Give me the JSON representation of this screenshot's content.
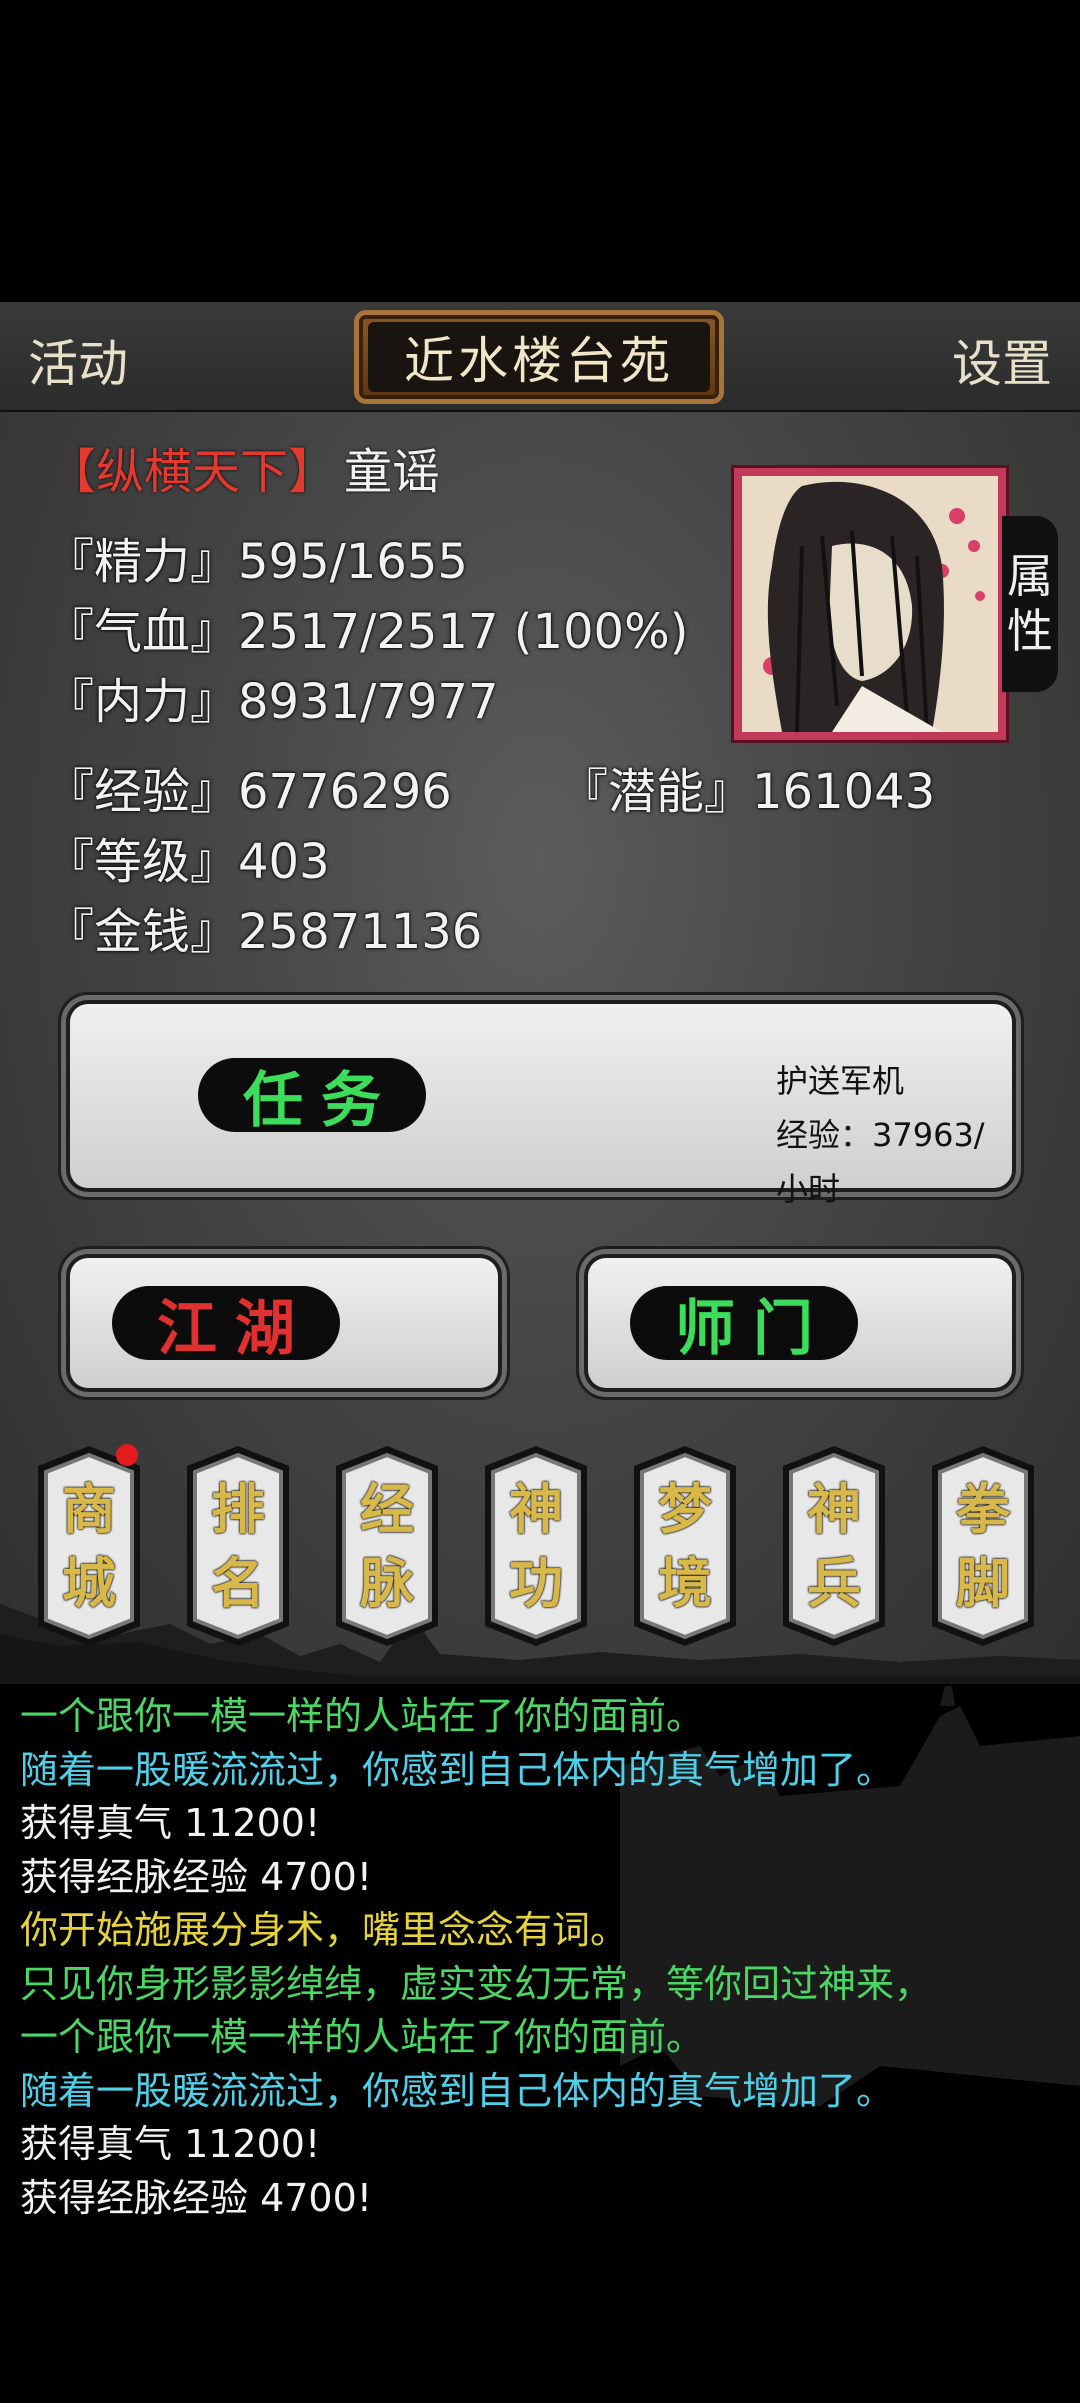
{
  "header": {
    "left_button": "活动",
    "title": "近水楼台苑",
    "right_button": "设置"
  },
  "player": {
    "faction": "【纵横天下】",
    "name": "童谣",
    "attributes_tab": [
      "属",
      "性"
    ]
  },
  "stats": {
    "energy": "『精力』595/1655",
    "health": "『气血』2517/2517 (100%)",
    "inner_force": "『内力』8931/7977",
    "experience": "『经验』6776296",
    "potential": "『潜能』161043",
    "level": "『等级』403",
    "money": "『金钱』25871136"
  },
  "mission": {
    "button_label": "任务",
    "task_name": "护送军机",
    "rate": "经验：37963/小时"
  },
  "jianghu_button": "江湖",
  "shimen_button": "师门",
  "menu": [
    {
      "top": "商",
      "bottom": "城",
      "has_notification": true
    },
    {
      "top": "排",
      "bottom": "名",
      "has_notification": false
    },
    {
      "top": "经",
      "bottom": "脉",
      "has_notification": false
    },
    {
      "top": "神",
      "bottom": "功",
      "has_notification": false
    },
    {
      "top": "梦",
      "bottom": "境",
      "has_notification": false
    },
    {
      "top": "神",
      "bottom": "兵",
      "has_notification": false
    },
    {
      "top": "拳",
      "bottom": "脚",
      "has_notification": false
    }
  ],
  "log": [
    {
      "text": "一个跟你一模一样的人站在了你的面前。",
      "color": "green"
    },
    {
      "text": "随着一股暖流流过，你感到自己体内的真气增加了。",
      "color": "cyan"
    },
    {
      "text": "获得真气 11200!",
      "color": "white"
    },
    {
      "text": "获得经脉经验 4700!",
      "color": "white"
    },
    {
      "text": "你开始施展分身术，嘴里念念有词。",
      "color": "yellow"
    },
    {
      "text": "只见你身形影影绰绰，虚实变幻无常，等你回过神来，",
      "color": "green"
    },
    {
      "text": "一个跟你一模一样的人站在了你的面前。",
      "color": "green"
    },
    {
      "text": "随着一股暖流流过，你感到自己体内的真气增加了。",
      "color": "cyan"
    },
    {
      "text": "获得真气 11200!",
      "color": "white"
    },
    {
      "text": "获得经脉经验 4700!",
      "color": "white"
    }
  ],
  "colors": {
    "faction_red": "#e4392f",
    "mission_green": "#3cdd5a",
    "jianghu_red": "#e03030",
    "scroll_gold": "#d9b84a",
    "log_green": "#4ad764",
    "log_cyan": "#4fd0e8",
    "log_yellow": "#e6d23a",
    "notification": "#e21c1c"
  }
}
